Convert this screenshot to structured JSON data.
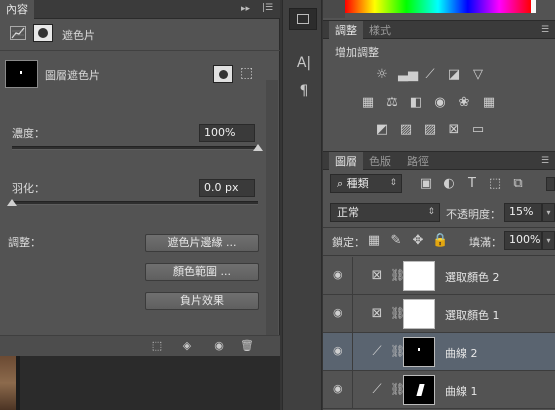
{
  "properties_panel": {
    "tab_label": "內容",
    "mask_mode_label": "遮色片",
    "layer_mask_label": "圖層遮色片",
    "density_label": "濃度：",
    "density_value": "100%",
    "density_level_percent": 100,
    "feather_label": "羽化：",
    "feather_value": "0.0 px",
    "feather_level_percent": 0,
    "refine_label": "調整：",
    "buttons": {
      "mask_edge": "遮色片邊緣 ...",
      "color_range": "顏色範圍 ...",
      "invert": "負片效果"
    }
  },
  "adjustments_panel": {
    "tabs": [
      "調整",
      "樣式"
    ],
    "add_adjustment_label": "增加調整"
  },
  "layers_panel": {
    "tabs": [
      "圖層",
      "色版",
      "路徑"
    ],
    "filter_kind": "種類",
    "blend_mode": "正常",
    "opacity_label": "不透明度：",
    "opacity_value": "15%",
    "lock_label": "鎖定：",
    "fill_label": "填滿：",
    "fill_value": "100%",
    "layers": [
      {
        "name": "選取顏色 2",
        "type": "selective-color",
        "thumb": "white",
        "selected": false
      },
      {
        "name": "選取顏色 1",
        "type": "selective-color",
        "thumb": "white",
        "selected": false
      },
      {
        "name": "曲線 2",
        "type": "curves",
        "thumb": "black",
        "selected": true
      },
      {
        "name": "曲線 1",
        "type": "curves",
        "thumb": "black-mark",
        "selected": false
      }
    ]
  },
  "icons": {
    "tool_a": "A|",
    "tool_para": "¶"
  }
}
